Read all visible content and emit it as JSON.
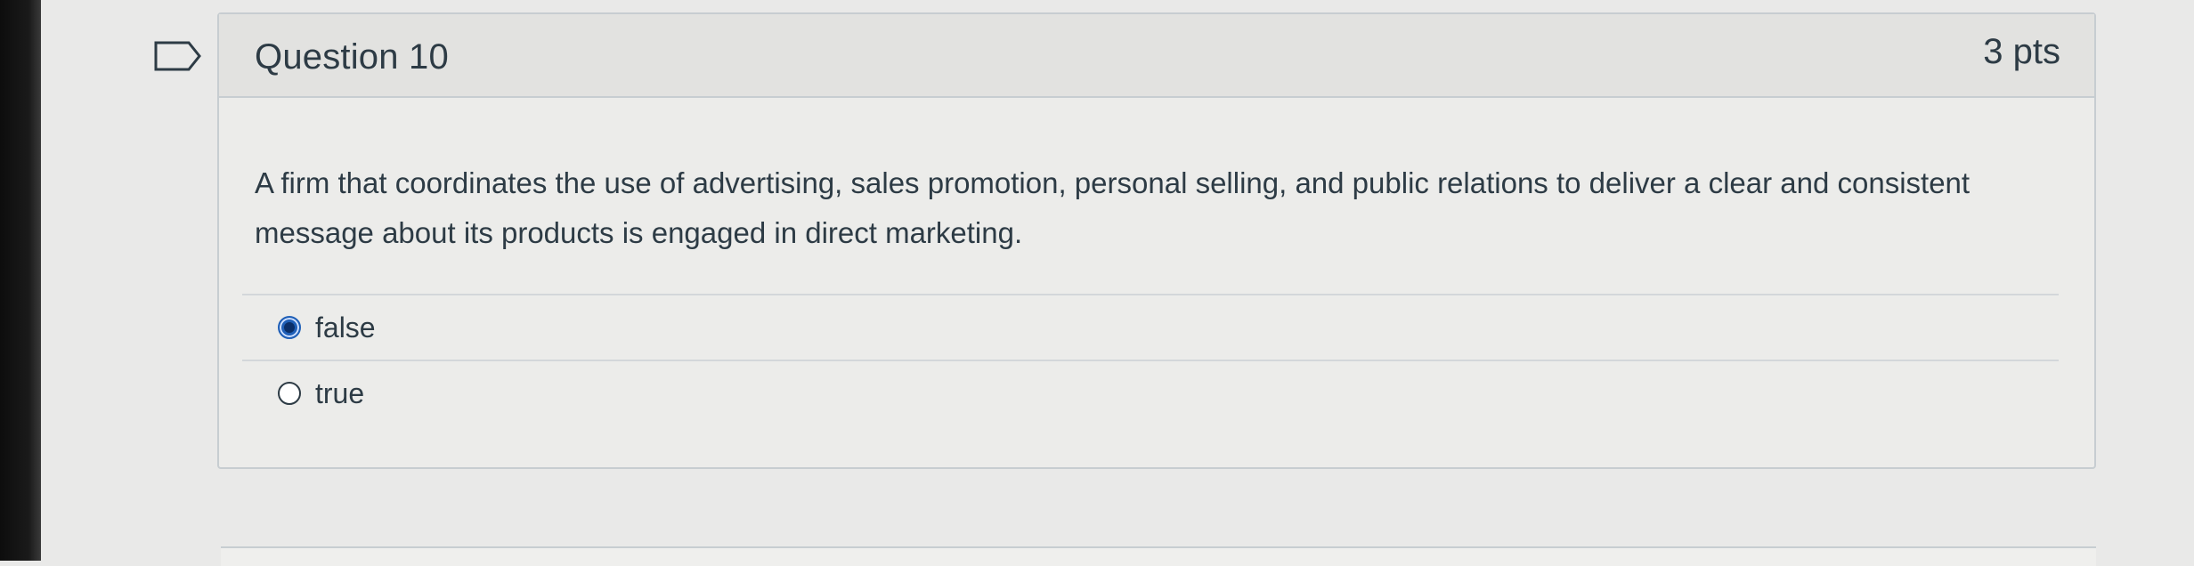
{
  "question": {
    "title": "Question 10",
    "points": "3 pts",
    "text": "A firm that coordinates the use of advertising, sales promotion, personal selling, and public relations to deliver a clear and consistent message about its products is engaged in direct marketing.",
    "flag_icon": "flag-icon"
  },
  "answers": [
    {
      "label": "false",
      "selected": true
    },
    {
      "label": "true",
      "selected": false
    }
  ],
  "colors": {
    "selected_radio": "#1f5fb7",
    "text": "#2d3b45",
    "border": "#c7cdd1"
  }
}
